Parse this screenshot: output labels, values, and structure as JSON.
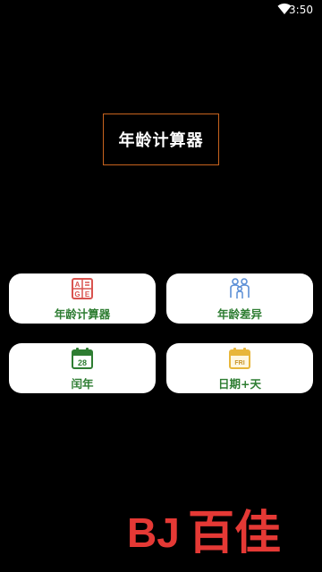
{
  "status_bar": {
    "time": "3:50",
    "icons": [
      "wifi-icon",
      "battery-icon"
    ]
  },
  "app_title": "年龄计算器",
  "menu": {
    "age_calculator": {
      "label": "年龄计算器",
      "icon": "age-grid-icon",
      "icon_letters": [
        "A",
        "G",
        "E"
      ],
      "color": "#d9534f"
    },
    "age_difference": {
      "label": "年龄差异",
      "icon": "people-icon",
      "color": "#5b8fd6"
    },
    "leap_year": {
      "label": "闰年",
      "icon": "calendar-icon",
      "calendar_day": "28",
      "color": "#2e7d32"
    },
    "date_plus_days": {
      "label": "日期+天",
      "icon": "calendar-fri-icon",
      "calendar_day": "FRI",
      "color": "#e8b63a"
    }
  },
  "watermark": {
    "text": "百佳",
    "logo_letters": "BJ",
    "color": "#e53935"
  }
}
